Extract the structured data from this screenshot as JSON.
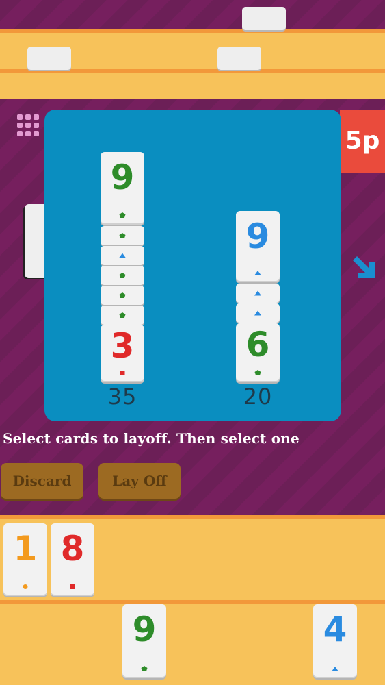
{
  "opponent_rack": {},
  "menu": {
    "icon": "grid-menu-icon"
  },
  "score_badge": {
    "text": "5p",
    "color": "#ea4b3c"
  },
  "layoff_panel": {
    "melds": [
      {
        "top": {
          "value": "9",
          "color": "#2e8c2a",
          "symbol": "pentagon"
        },
        "middle_symbols": [
          "pentagon",
          "triangle",
          "pentagon",
          "pentagon",
          "pentagon"
        ],
        "bottom": {
          "value": "3",
          "color": "#e02a2a",
          "symbol": "square"
        },
        "score": "35"
      },
      {
        "top": {
          "value": "9",
          "color": "#2a8be0",
          "symbol": "triangle"
        },
        "middle_symbols": [
          "triangle",
          "triangle"
        ],
        "bottom": {
          "value": "6",
          "color": "#2e8c2a",
          "symbol": "pentagon"
        },
        "score": "20"
      }
    ]
  },
  "instruction": "Select cards to layoff. Then select one",
  "buttons": {
    "discard": "Discard",
    "lay_off": "Lay Off"
  },
  "player_hand": [
    {
      "value": "1",
      "color": "#f39a1e",
      "symbol": "dot"
    },
    {
      "value": "8",
      "color": "#e02a2a",
      "symbol": "square"
    },
    {
      "value": "9",
      "color": "#2e8c2a",
      "symbol": "pentagon"
    },
    {
      "value": "4",
      "color": "#2a8be0",
      "symbol": "triangle"
    }
  ]
}
